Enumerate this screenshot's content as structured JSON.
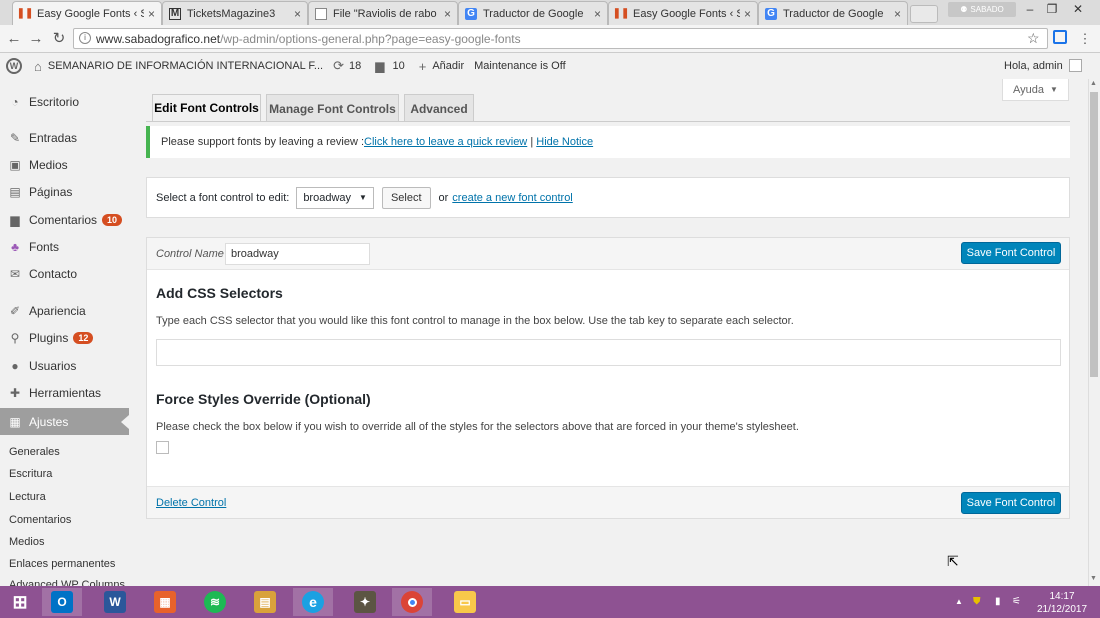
{
  "browser": {
    "tabs": [
      {
        "title": "Easy Google Fonts ‹ SEM",
        "icon": "wordpress-pause-icon",
        "active": true
      },
      {
        "title": "TicketsMagazine3",
        "icon": "gmail-icon",
        "active": false
      },
      {
        "title": "File \"Raviolis de rabo de",
        "icon": "document-icon",
        "active": false
      },
      {
        "title": "Traductor de Google",
        "icon": "google-translate-icon",
        "active": false
      },
      {
        "title": "Easy Google Fonts ‹ SEM",
        "icon": "wordpress-pause-icon",
        "active": false
      },
      {
        "title": "Traductor de Google",
        "icon": "google-translate-icon",
        "active": false
      }
    ],
    "profile_name": "SABADO",
    "url_host": "www.sabadografico.net",
    "url_path": "/wp-admin/options-general.php?page=easy-google-fonts"
  },
  "adminbar": {
    "site_name": "SEMANARIO DE INFORMACIÓN INTERNACIONAL F...",
    "updates_count": "18",
    "comments_count": "10",
    "add_new": "Añadir",
    "maintenance": "Maintenance is Off",
    "greeting": "Hola, admin"
  },
  "sidebar": {
    "items": [
      {
        "label": "Escritorio",
        "icon": "dashboard-icon"
      },
      {
        "label": "Entradas",
        "icon": "pin-icon"
      },
      {
        "label": "Medios",
        "icon": "media-icon"
      },
      {
        "label": "Páginas",
        "icon": "pages-icon"
      },
      {
        "label": "Comentarios",
        "icon": "comments-icon",
        "badge": "10"
      },
      {
        "label": "Fonts",
        "icon": "fonts-icon"
      },
      {
        "label": "Contacto",
        "icon": "mail-icon"
      },
      {
        "label": "Apariencia",
        "icon": "brush-icon"
      },
      {
        "label": "Plugins",
        "icon": "plugin-icon",
        "badge": "12"
      },
      {
        "label": "Usuarios",
        "icon": "users-icon"
      },
      {
        "label": "Herramientas",
        "icon": "tools-icon"
      },
      {
        "label": "Ajustes",
        "icon": "settings-icon",
        "current": true
      }
    ],
    "submenu": [
      "Generales",
      "Escritura",
      "Lectura",
      "Comentarios",
      "Medios",
      "Enlaces permanentes",
      "Advanced WP Columns"
    ]
  },
  "help_label": "Ayuda",
  "nav_tabs": [
    "Edit Font Controls",
    "Manage Font Controls",
    "Advanced"
  ],
  "notice": {
    "text": "Please support fonts by leaving a review : ",
    "review_link": "Click here to leave a quick review",
    "separator": " | ",
    "hide_link": "Hide Notice"
  },
  "select_control": {
    "label": "Select a font control to edit:",
    "selected": "broadway",
    "button": "Select",
    "or_text": "or",
    "create_link": "create a new font control"
  },
  "control": {
    "name_label": "Control Name",
    "name_value": "broadway",
    "save_label": "Save Font Control",
    "css_heading": "Add CSS Selectors",
    "css_help": "Type each CSS selector that you would like this font control to manage in the box below. Use the tab key to separate each selector.",
    "force_heading": "Force Styles Override (Optional)",
    "force_help": "Please check the box below if you wish to override all of the styles for the selectors above that are forced in your theme's stylesheet.",
    "delete_label": "Delete Control"
  },
  "taskbar": {
    "time": "14:17",
    "date": "21/12/2017"
  }
}
